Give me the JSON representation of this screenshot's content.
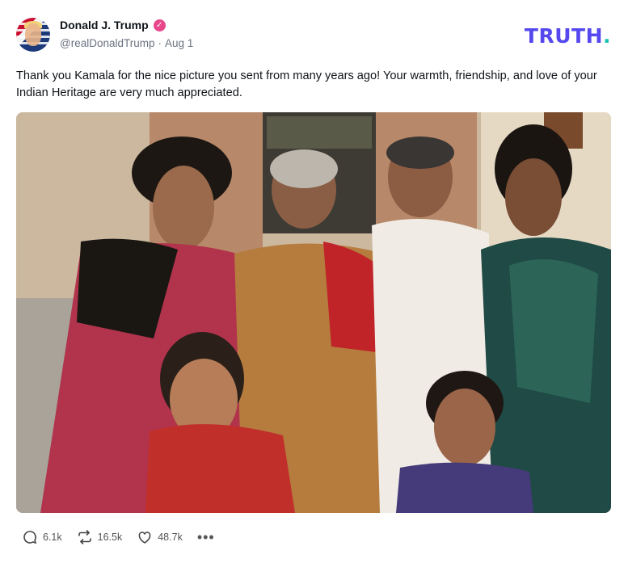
{
  "author": {
    "display_name": "Donald J. Trump",
    "handle": "@realDonaldTrump",
    "separator": "·",
    "date": "Aug 1",
    "avatar_icon": "avatar-flag-portrait",
    "verified_icon": "verified-badge-icon",
    "verified_color": "#e8478b"
  },
  "brand": {
    "logo_text": "TRUTH",
    "logo_dot": ".",
    "logo_color": "#5448ee",
    "dot_color": "#17c3b2"
  },
  "post": {
    "text": "Thank you Kamala for the nice picture you sent from many years ago! Your warmth, friendship, and love of your Indian Heritage are very much appreciated.",
    "image_alt": "family photo"
  },
  "actions": {
    "replies": "6.1k",
    "retruths": "16.5k",
    "likes": "48.7k",
    "more": "•••",
    "reply_icon": "reply-icon",
    "retruth_icon": "retruth-icon",
    "like_icon": "heart-icon",
    "more_icon": "more-dots-icon"
  }
}
